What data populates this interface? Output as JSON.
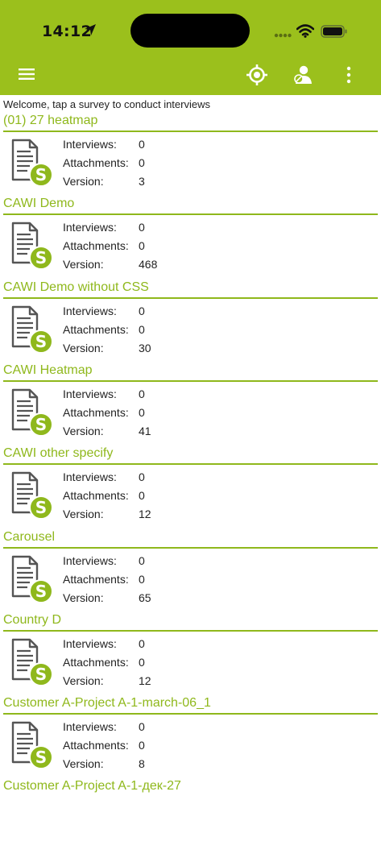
{
  "status": {
    "time": "14:12"
  },
  "welcome": "Welcome, tap a survey to conduct interviews",
  "labels": {
    "interviews": "Interviews:",
    "attachments": "Attachments:",
    "version": "Version:"
  },
  "surveys": [
    {
      "title": "(01) 27 heatmap",
      "interviews": "0",
      "attachments": "0",
      "version": "3"
    },
    {
      "title": "CAWI Demo",
      "interviews": "0",
      "attachments": "0",
      "version": "468"
    },
    {
      "title": "CAWI Demo without CSS",
      "interviews": "0",
      "attachments": "0",
      "version": "30"
    },
    {
      "title": "CAWI Heatmap",
      "interviews": "0",
      "attachments": "0",
      "version": "41"
    },
    {
      "title": "CAWI other specify",
      "interviews": "0",
      "attachments": "0",
      "version": "12"
    },
    {
      "title": "Carousel",
      "interviews": "0",
      "attachments": "0",
      "version": "65"
    },
    {
      "title": "Country D",
      "interviews": "0",
      "attachments": "0",
      "version": "12"
    },
    {
      "title": "Customer A-Project A-1-march-06_1",
      "interviews": "0",
      "attachments": "0",
      "version": "8"
    },
    {
      "title": "Customer A-Project A-1-дек-27"
    }
  ],
  "icons": {
    "menu": "hamburger-menu-icon",
    "gps": "location-target-icon",
    "user": "user-status-icon",
    "more": "more-vertical-icon",
    "survey": "survey-document-icon"
  },
  "colors": {
    "brand": "#9bc01c",
    "title": "#8fb81c",
    "badge": "#8fb81c"
  }
}
